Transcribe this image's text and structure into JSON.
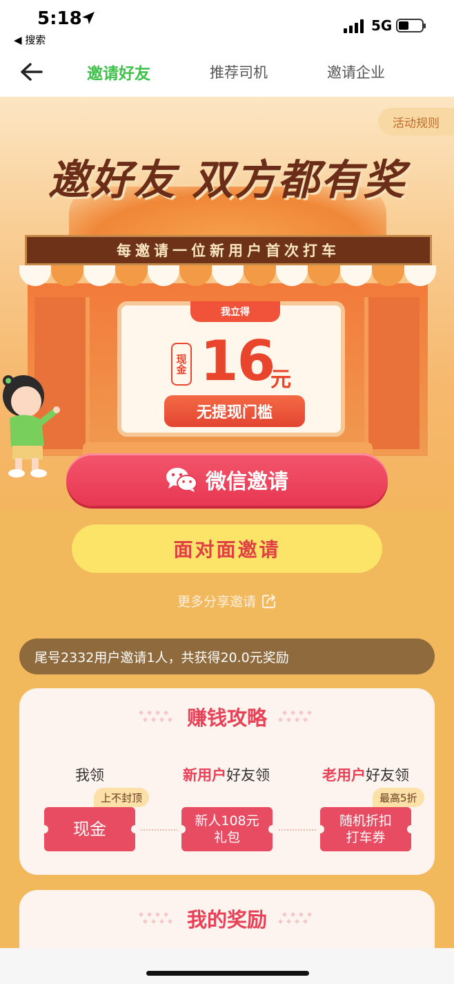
{
  "status_bar": {
    "time": "5:18",
    "back_app": "◀ 搜索",
    "network": "5G"
  },
  "nav": {
    "tabs": [
      {
        "label": "邀请好友",
        "active": true
      },
      {
        "label": "推荐司机",
        "active": false
      },
      {
        "label": "邀请企业",
        "active": false
      }
    ]
  },
  "hero": {
    "rules_label": "活动规则",
    "headline": "邀好友 双方都有奖",
    "banner": "每邀请一位新用户首次打车",
    "card_tag": "我立得",
    "cash_label": "现金",
    "amount": "16",
    "unit": "元",
    "no_limit": "无提现门槛"
  },
  "actions": {
    "wechat_invite": "微信邀请",
    "face_invite": "面对面邀请",
    "more_share": "更多分享邀请"
  },
  "notice": "尾号2332用户邀请1人，共获得20.0元奖励",
  "strategy": {
    "title": "赚钱攻略",
    "columns": [
      {
        "head_plain": "我领",
        "head_em": "",
        "ticket": "现金",
        "chip": "上不封顶"
      },
      {
        "head_em": "新用户",
        "head_plain": "好友领",
        "ticket": "新人108元\n礼包",
        "chip": ""
      },
      {
        "head_em": "老用户",
        "head_plain": "好友领",
        "ticket": "随机折扣\n打车券",
        "chip": "最高5折"
      }
    ]
  },
  "rewards": {
    "title": "我的奖励"
  },
  "colors": {
    "brand_green": "#3ec24a",
    "accent_red": "#e84157",
    "button_yellow": "#fbe468"
  },
  "icons": [
    "location-arrow-icon",
    "signal-icon",
    "battery-icon",
    "back-arrow-icon",
    "wechat-icon",
    "share-icon"
  ]
}
